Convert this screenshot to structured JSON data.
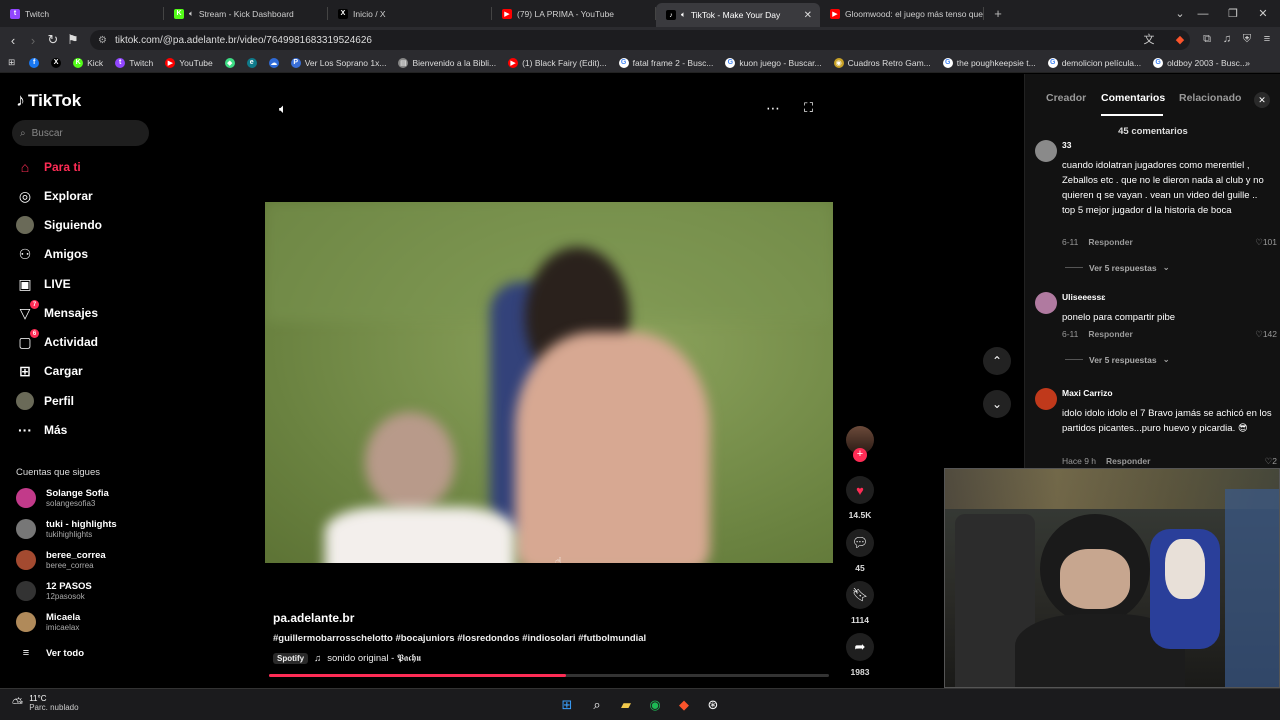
{
  "browser": {
    "tabs": [
      {
        "title": "Twitch",
        "favicon": "twitch-icon",
        "color": "#9146ff",
        "glyph": "t"
      },
      {
        "title": "Stream - Kick Dashboard",
        "favicon": "kick-icon",
        "color": "#53fc18",
        "glyph": "K"
      },
      {
        "title": "Inicio / X",
        "favicon": "x-icon",
        "color": "#000000",
        "glyph": "X"
      },
      {
        "title": "(79) LA PRIMA - YouTube",
        "favicon": "youtube-icon",
        "color": "#ff0000",
        "glyph": "▶"
      },
      {
        "title": "TikTok - Make Your Day",
        "favicon": "tiktok-icon",
        "color": "#000000",
        "glyph": "♪",
        "active": true
      },
      {
        "title": "Gloomwood: el juego más tenso que",
        "favicon": "youtube-icon",
        "color": "#ff0000",
        "glyph": "▶"
      }
    ],
    "url": "tiktok.com/@pa.adelante.br/video/7649981683319524626",
    "bookmarks": [
      {
        "label": "",
        "icon": "facebook-icon",
        "color": "#1877f2",
        "glyph": "f"
      },
      {
        "label": "",
        "icon": "x-icon",
        "color": "#000000",
        "glyph": "X"
      },
      {
        "label": "Kick",
        "icon": "kick-icon",
        "color": "#53fc18",
        "glyph": "K"
      },
      {
        "label": "Twitch",
        "icon": "twitch-icon",
        "color": "#9146ff",
        "glyph": "t"
      },
      {
        "label": "YouTube",
        "icon": "youtube-icon",
        "color": "#ff0000",
        "glyph": "▶"
      },
      {
        "label": "",
        "icon": "android-icon",
        "color": "#3ddc84",
        "glyph": "◆"
      },
      {
        "label": "",
        "icon": "edge-icon",
        "color": "#0f7a8a",
        "glyph": "e"
      },
      {
        "label": "",
        "icon": "cloud-icon",
        "color": "#2f6bd8",
        "glyph": "☁"
      },
      {
        "label": "Ver Los Soprano 1x...",
        "icon": "page-icon",
        "color": "#3a6fd8",
        "glyph": "P"
      },
      {
        "label": "Bienvenido a la Bibli...",
        "icon": "doc-icon",
        "color": "#888888",
        "glyph": "▤"
      },
      {
        "label": "(1) Black Fairy (Edit)...",
        "icon": "youtube-icon",
        "color": "#ff0000",
        "glyph": "▶"
      },
      {
        "label": "fatal frame 2 - Busc...",
        "icon": "google-icon",
        "color": "#ffffff",
        "glyph": "G"
      },
      {
        "label": "kuon juego - Buscar...",
        "icon": "google-icon",
        "color": "#ffffff",
        "glyph": "G"
      },
      {
        "label": "Cuadros Retro Gam...",
        "icon": "shop-icon",
        "color": "#c9a227",
        "glyph": "◉"
      },
      {
        "label": "the poughkeepsie t...",
        "icon": "google-icon",
        "color": "#ffffff",
        "glyph": "G"
      },
      {
        "label": "demolicion película...",
        "icon": "google-icon",
        "color": "#ffffff",
        "glyph": "G"
      },
      {
        "label": "oldboy 2003 - Busc...",
        "icon": "google-icon",
        "color": "#ffffff",
        "glyph": "G"
      }
    ]
  },
  "tiktok": {
    "logo": "TikTok",
    "search_placeholder": "Buscar",
    "nav": [
      {
        "label": "Para ti",
        "icon": "home-icon",
        "glyph": "⌂",
        "active": true
      },
      {
        "label": "Explorar",
        "icon": "compass-icon",
        "glyph": "◎"
      },
      {
        "label": "Siguiendo",
        "icon": "following-avatar-icon",
        "glyph": "●"
      },
      {
        "label": "Amigos",
        "icon": "friends-icon",
        "glyph": "⚇"
      },
      {
        "label": "LIVE",
        "icon": "live-icon",
        "glyph": "▣"
      },
      {
        "label": "Mensajes",
        "icon": "messages-icon",
        "glyph": "▽",
        "badge": "7"
      },
      {
        "label": "Actividad",
        "icon": "activity-icon",
        "glyph": "▢",
        "badge": "6"
      },
      {
        "label": "Cargar",
        "icon": "upload-icon",
        "glyph": "⊞"
      },
      {
        "label": "Perfil",
        "icon": "profile-avatar-icon",
        "glyph": "●"
      },
      {
        "label": "Más",
        "icon": "more-icon",
        "glyph": "···"
      }
    ],
    "following_title": "Cuentas que sigues",
    "following": [
      {
        "name": "Solange Sofia",
        "handle": "solangesofia3",
        "color": "#c23a8a"
      },
      {
        "name": "tuki - highlights",
        "handle": "tukihighlights",
        "color": "#777777"
      },
      {
        "name": "beree_correa",
        "handle": "beree_correa",
        "color": "#a34a30"
      },
      {
        "name": "12 PASOS",
        "handle": "12pasosok",
        "color": "#333333"
      },
      {
        "name": "Micaela",
        "handle": "imicaelax",
        "color": "#b08a5a"
      }
    ],
    "see_all": "Ver todo",
    "video": {
      "author": "pa.adelante.br",
      "hashtags": "#guillermobarrosschelotto #bocajuniors #losredondos #indiosolari #futbolmundial",
      "spotify": "Spotify",
      "sound": "sonido original - 𝕻𝖆𝖈𝖍𝖚",
      "progress": 0.53
    },
    "actions": {
      "likes": "14.5K",
      "comments": "45",
      "saves": "1114",
      "shares": "1983"
    }
  },
  "panel": {
    "tabs": [
      "Creador",
      "Comentarios",
      "Relacionado"
    ],
    "count": "45 comentarios",
    "comments": [
      {
        "user": "33",
        "text": "cuando idolatran jugadores como merentiel , Zeballos etc . que no le dieron nada al club y no quieren q se vayan . vean un video del guille .. top 5 mejor jugador d la historia de boca",
        "date": "6-11",
        "reply": "Responder",
        "likes": "101",
        "more": "Ver 5 respuestas",
        "color": "#8a8a8a"
      },
      {
        "user": "Uliseeessɛ",
        "text": "ponelo para compartir pibe",
        "date": "6-11",
        "reply": "Responder",
        "likes": "142",
        "more": "Ver 5 respuestas",
        "color": "#b07aa0"
      },
      {
        "user": "Maxi Carrizo",
        "text": "idolo idolo idolo el 7 Bravo jamás se achicó en los partidos picantes...puro huevo y picardia. 😎",
        "date": "Hace 9 h",
        "reply": "Responder",
        "likes": "2",
        "color": "#c0391b"
      }
    ]
  },
  "taskbar": {
    "temp": "11°C",
    "weather": "Parc. nublado"
  }
}
